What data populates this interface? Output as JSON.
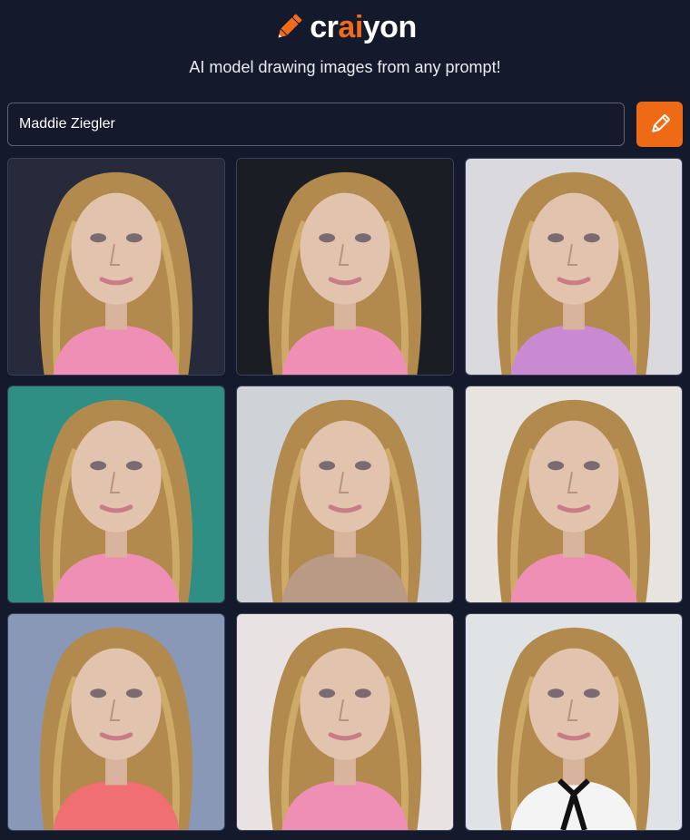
{
  "brand": {
    "logo_pre": "cr",
    "logo_accent": "ai",
    "logo_post": "yon",
    "accent_color": "#f26b1d",
    "icon": "pencil-icon"
  },
  "tagline": "AI model drawing images from any prompt!",
  "search": {
    "value": "Maddie Ziegler",
    "button_icon": "pencil-icon",
    "button_color": "#ef6a14"
  },
  "results": {
    "count": 9,
    "tiles": [
      {
        "bg": "#262a3a",
        "top": "pink"
      },
      {
        "bg": "#1a1d24",
        "top": "pink"
      },
      {
        "bg": "#d9d9de",
        "top": "lilac jacket"
      },
      {
        "bg": "#2f8f84",
        "top": "pink"
      },
      {
        "bg": "#cfd2d6",
        "top": "tan"
      },
      {
        "bg": "#e7e3de",
        "top": "pink"
      },
      {
        "bg": "#8a98b8",
        "top": "coral"
      },
      {
        "bg": "#e8e3e2",
        "top": "pink"
      },
      {
        "bg": "#dfe3e6",
        "top": "white blouse with black bow"
      }
    ]
  }
}
